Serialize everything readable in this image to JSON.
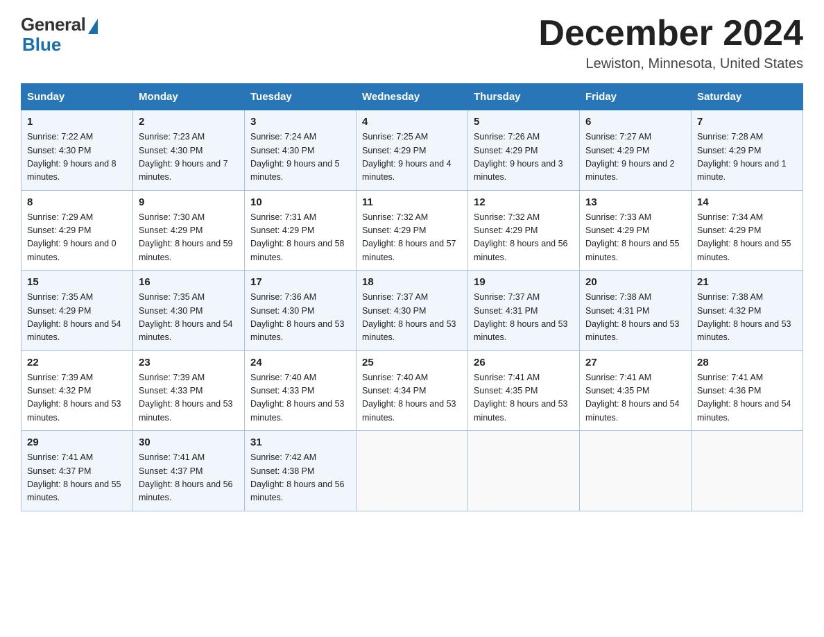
{
  "header": {
    "logo_general": "General",
    "logo_blue": "Blue",
    "month_title": "December 2024",
    "location": "Lewiston, Minnesota, United States"
  },
  "weekdays": [
    "Sunday",
    "Monday",
    "Tuesday",
    "Wednesday",
    "Thursday",
    "Friday",
    "Saturday"
  ],
  "weeks": [
    [
      {
        "day": "1",
        "sunrise": "7:22 AM",
        "sunset": "4:30 PM",
        "daylight": "9 hours and 8 minutes."
      },
      {
        "day": "2",
        "sunrise": "7:23 AM",
        "sunset": "4:30 PM",
        "daylight": "9 hours and 7 minutes."
      },
      {
        "day": "3",
        "sunrise": "7:24 AM",
        "sunset": "4:30 PM",
        "daylight": "9 hours and 5 minutes."
      },
      {
        "day": "4",
        "sunrise": "7:25 AM",
        "sunset": "4:29 PM",
        "daylight": "9 hours and 4 minutes."
      },
      {
        "day": "5",
        "sunrise": "7:26 AM",
        "sunset": "4:29 PM",
        "daylight": "9 hours and 3 minutes."
      },
      {
        "day": "6",
        "sunrise": "7:27 AM",
        "sunset": "4:29 PM",
        "daylight": "9 hours and 2 minutes."
      },
      {
        "day": "7",
        "sunrise": "7:28 AM",
        "sunset": "4:29 PM",
        "daylight": "9 hours and 1 minute."
      }
    ],
    [
      {
        "day": "8",
        "sunrise": "7:29 AM",
        "sunset": "4:29 PM",
        "daylight": "9 hours and 0 minutes."
      },
      {
        "day": "9",
        "sunrise": "7:30 AM",
        "sunset": "4:29 PM",
        "daylight": "8 hours and 59 minutes."
      },
      {
        "day": "10",
        "sunrise": "7:31 AM",
        "sunset": "4:29 PM",
        "daylight": "8 hours and 58 minutes."
      },
      {
        "day": "11",
        "sunrise": "7:32 AM",
        "sunset": "4:29 PM",
        "daylight": "8 hours and 57 minutes."
      },
      {
        "day": "12",
        "sunrise": "7:32 AM",
        "sunset": "4:29 PM",
        "daylight": "8 hours and 56 minutes."
      },
      {
        "day": "13",
        "sunrise": "7:33 AM",
        "sunset": "4:29 PM",
        "daylight": "8 hours and 55 minutes."
      },
      {
        "day": "14",
        "sunrise": "7:34 AM",
        "sunset": "4:29 PM",
        "daylight": "8 hours and 55 minutes."
      }
    ],
    [
      {
        "day": "15",
        "sunrise": "7:35 AM",
        "sunset": "4:29 PM",
        "daylight": "8 hours and 54 minutes."
      },
      {
        "day": "16",
        "sunrise": "7:35 AM",
        "sunset": "4:30 PM",
        "daylight": "8 hours and 54 minutes."
      },
      {
        "day": "17",
        "sunrise": "7:36 AM",
        "sunset": "4:30 PM",
        "daylight": "8 hours and 53 minutes."
      },
      {
        "day": "18",
        "sunrise": "7:37 AM",
        "sunset": "4:30 PM",
        "daylight": "8 hours and 53 minutes."
      },
      {
        "day": "19",
        "sunrise": "7:37 AM",
        "sunset": "4:31 PM",
        "daylight": "8 hours and 53 minutes."
      },
      {
        "day": "20",
        "sunrise": "7:38 AM",
        "sunset": "4:31 PM",
        "daylight": "8 hours and 53 minutes."
      },
      {
        "day": "21",
        "sunrise": "7:38 AM",
        "sunset": "4:32 PM",
        "daylight": "8 hours and 53 minutes."
      }
    ],
    [
      {
        "day": "22",
        "sunrise": "7:39 AM",
        "sunset": "4:32 PM",
        "daylight": "8 hours and 53 minutes."
      },
      {
        "day": "23",
        "sunrise": "7:39 AM",
        "sunset": "4:33 PM",
        "daylight": "8 hours and 53 minutes."
      },
      {
        "day": "24",
        "sunrise": "7:40 AM",
        "sunset": "4:33 PM",
        "daylight": "8 hours and 53 minutes."
      },
      {
        "day": "25",
        "sunrise": "7:40 AM",
        "sunset": "4:34 PM",
        "daylight": "8 hours and 53 minutes."
      },
      {
        "day": "26",
        "sunrise": "7:41 AM",
        "sunset": "4:35 PM",
        "daylight": "8 hours and 53 minutes."
      },
      {
        "day": "27",
        "sunrise": "7:41 AM",
        "sunset": "4:35 PM",
        "daylight": "8 hours and 54 minutes."
      },
      {
        "day": "28",
        "sunrise": "7:41 AM",
        "sunset": "4:36 PM",
        "daylight": "8 hours and 54 minutes."
      }
    ],
    [
      {
        "day": "29",
        "sunrise": "7:41 AM",
        "sunset": "4:37 PM",
        "daylight": "8 hours and 55 minutes."
      },
      {
        "day": "30",
        "sunrise": "7:41 AM",
        "sunset": "4:37 PM",
        "daylight": "8 hours and 56 minutes."
      },
      {
        "day": "31",
        "sunrise": "7:42 AM",
        "sunset": "4:38 PM",
        "daylight": "8 hours and 56 minutes."
      },
      null,
      null,
      null,
      null
    ]
  ],
  "labels": {
    "sunrise": "Sunrise:",
    "sunset": "Sunset:",
    "daylight": "Daylight:"
  }
}
